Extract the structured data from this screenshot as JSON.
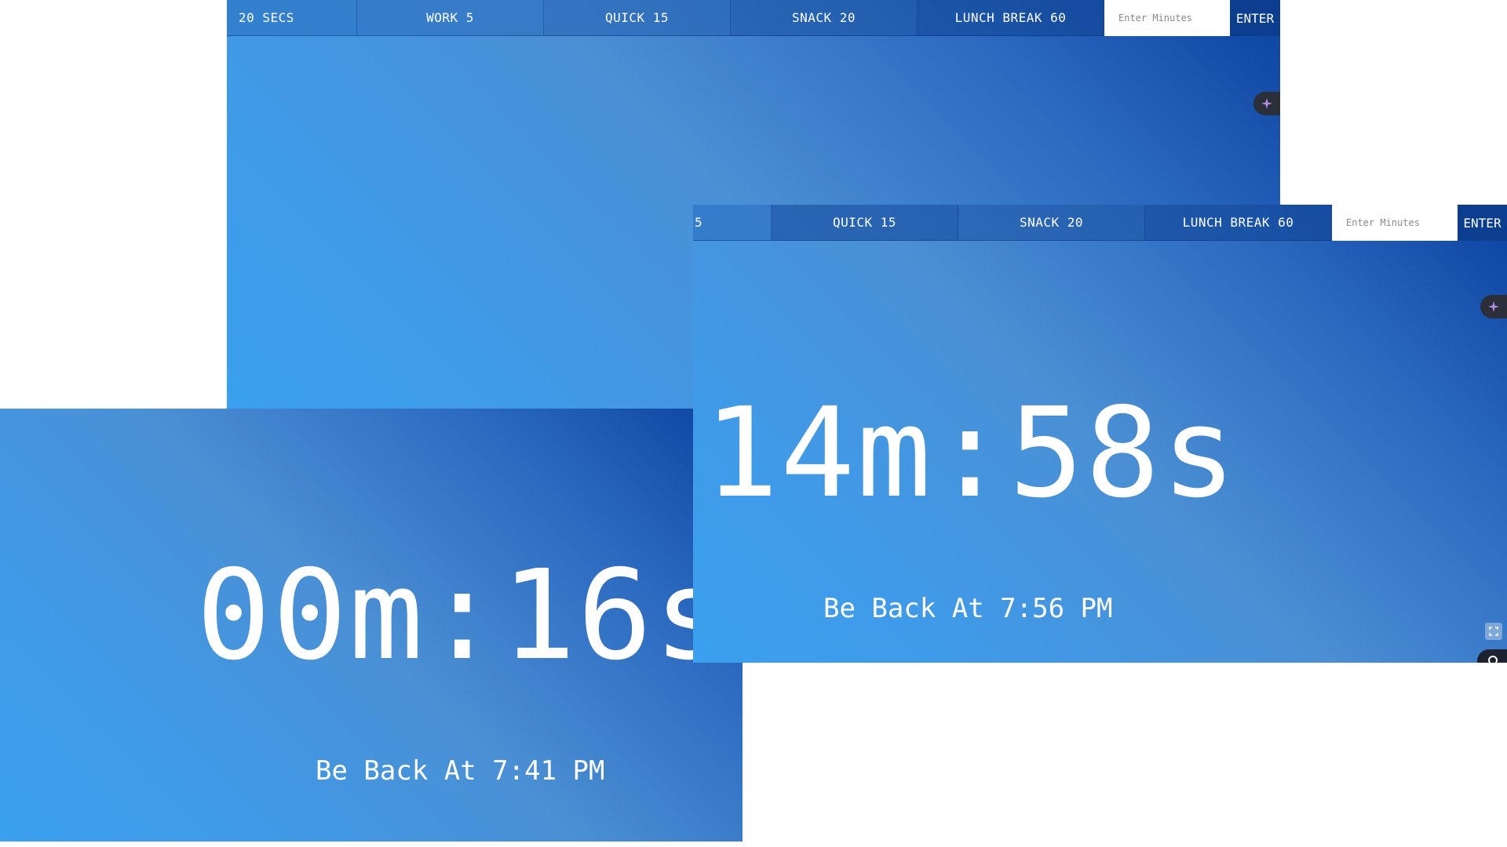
{
  "window_top": {
    "tabs": [
      "20 SECS",
      "WORK 5",
      "QUICK 15",
      "SNACK 20",
      "LUNCH BREAK 60"
    ],
    "input_placeholder": "Enter Minutes",
    "enter_label": "ENTER"
  },
  "window_bottom_left": {
    "timer": "00m:16s",
    "back_at": "Be Back At 7:41 PM"
  },
  "window_right": {
    "tab_partial": "5",
    "tabs": [
      "QUICK 15",
      "SNACK 20",
      "LUNCH BREAK 60"
    ],
    "input_placeholder": "Enter Minutes",
    "enter_label": "ENTER",
    "timer": "14m:58s",
    "back_at": "Be Back At 7:56 PM"
  },
  "icons": {
    "fab": "sparkle-icon",
    "corner": "expand-icon"
  }
}
